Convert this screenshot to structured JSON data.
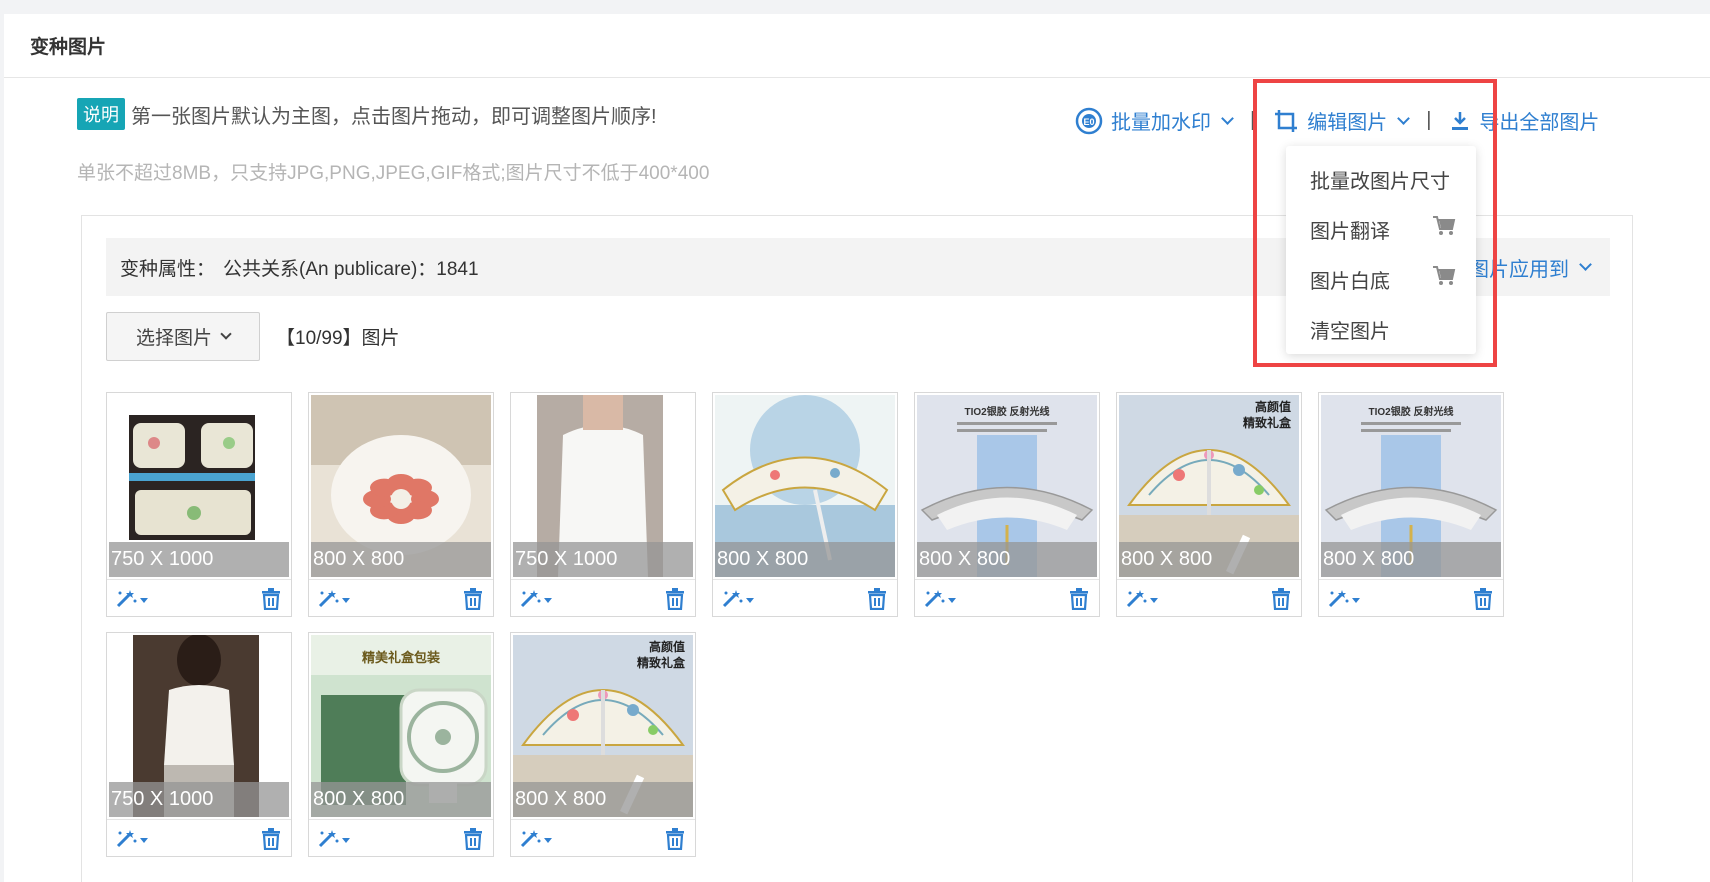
{
  "panel": {
    "title": "变种图片"
  },
  "note": {
    "badge": "说明",
    "text": "第一张图片默认为主图，点击图片拖动，即可调整图片顺序!",
    "sub": "单张不超过8MB，只支持JPG,PNG,JPEG,GIF格式;图片尺寸不低于400*400"
  },
  "toolbar": {
    "watermark": "批量加水印",
    "sep": "|",
    "edit": "编辑图片",
    "export": "导出全部图片"
  },
  "dropdown": {
    "items": [
      "批量改图片尺寸",
      "图片翻译",
      "图片白底",
      "清空图片"
    ]
  },
  "attr": {
    "label": "变种属性：",
    "value": "公共关系(An publicare)：1841",
    "apply": "图片应用到"
  },
  "select": {
    "button": "选择图片",
    "count": "【10/99】图片"
  },
  "images": [
    {
      "size": "750 X 1000",
      "kind": "seat"
    },
    {
      "size": "800 X 800",
      "kind": "chair"
    },
    {
      "size": "750 X 1000",
      "kind": "tank"
    },
    {
      "size": "800 X 800",
      "kind": "umbrella-blue"
    },
    {
      "size": "800 X 800",
      "kind": "umbrella-tio2",
      "caption": "TIO2银胶 反射光线"
    },
    {
      "size": "800 X 800",
      "kind": "umbrella-gift",
      "caption": "高颜值\n精致礼盒"
    },
    {
      "size": "800 X 800",
      "kind": "umbrella-tio2",
      "caption": "TIO2银胶 反射光线"
    },
    {
      "size": "750 X 1000",
      "kind": "woman"
    },
    {
      "size": "800 X 800",
      "kind": "fan",
      "caption": "精美礼盒包装"
    },
    {
      "size": "800 X 800",
      "kind": "umbrella-gift",
      "caption": "高颜值\n精致礼盒"
    }
  ],
  "colors": {
    "accent": "#2f7fd0",
    "badge": "#16a5b5",
    "highlight": "#ee4444"
  }
}
